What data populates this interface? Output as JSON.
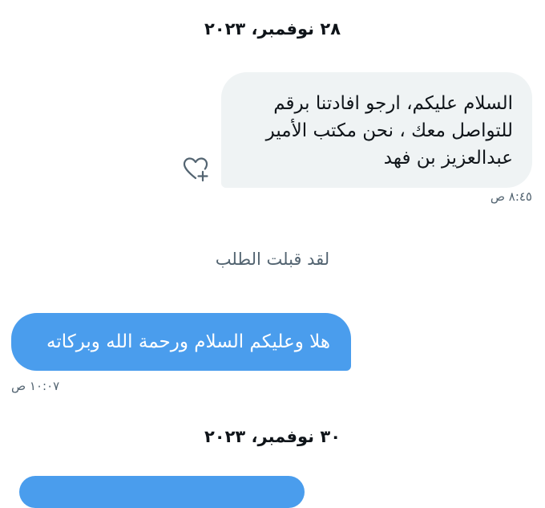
{
  "conversation": {
    "date_1": "٢٨ نوفمبر، ٢٠٢٣",
    "msg_1": {
      "lines": [
        "السلام عليكم، ارجو افادتنا برقم",
        "للتواصل معك ، نحن مكتب الأمير",
        "عبدالعزيز بن فهد"
      ],
      "time": "٨:٤٥ ص",
      "reaction_icon": "heart-plus-icon"
    },
    "system_msg": "لقد قبلت الطلب",
    "msg_2": {
      "text": "هلا وعليكم السلام ورحمة الله وبركاته",
      "time": "١٠:٠٧ ص"
    },
    "date_2": "٣٠ نوفمبر، ٢٠٢٣"
  },
  "colors": {
    "incoming_bubble": "#eff3f4",
    "outgoing_bubble": "#4a9ded",
    "meta_text": "#536471"
  }
}
